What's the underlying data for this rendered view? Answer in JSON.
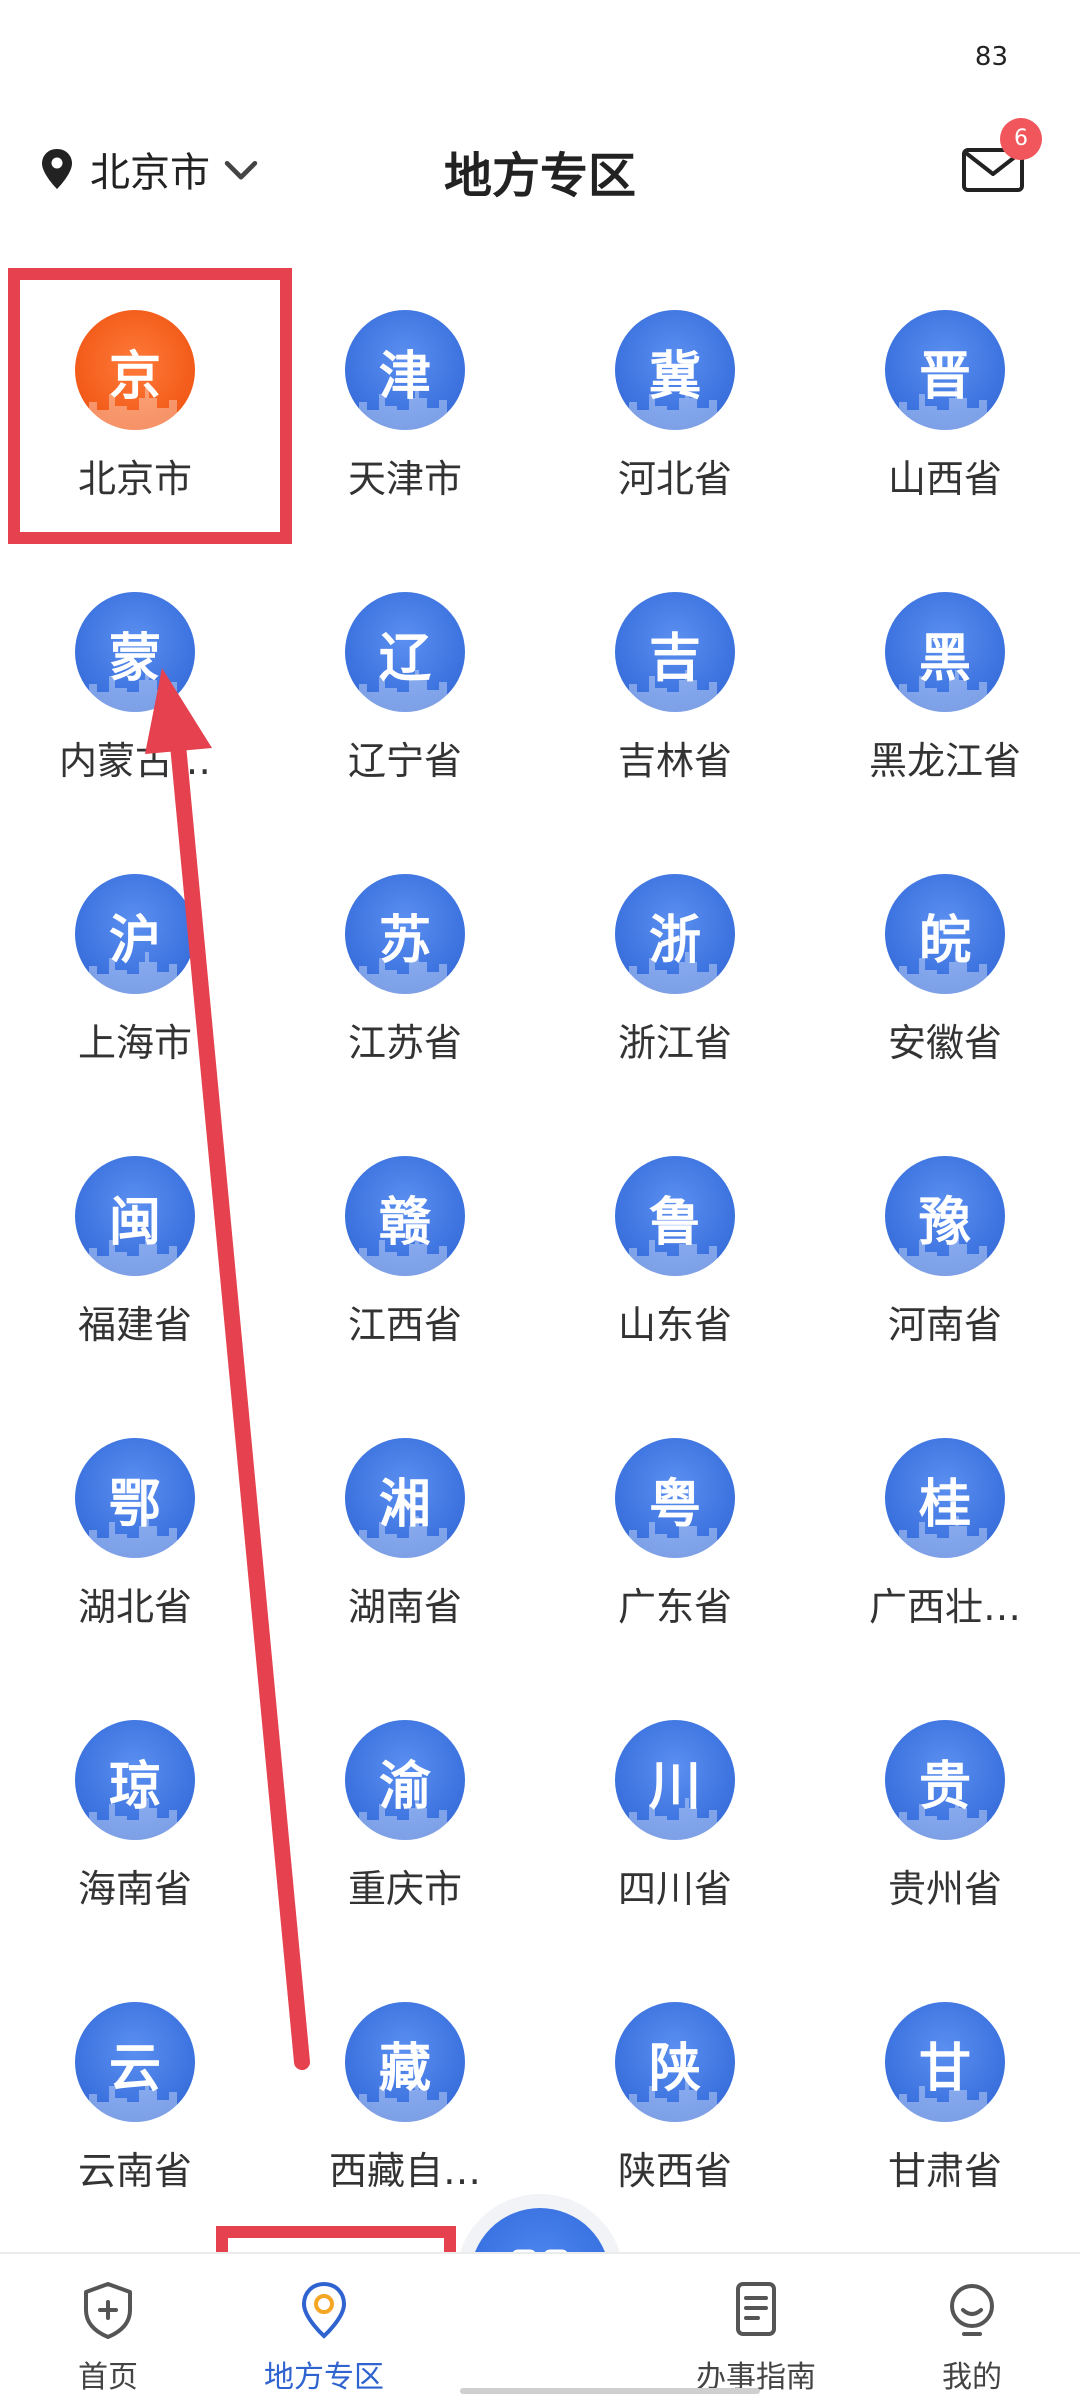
{
  "status": {
    "indicator": "83"
  },
  "header": {
    "location_icon": "location-pin-icon",
    "location_label": "北京市",
    "title": "地方专区",
    "mail_icon": "mail-icon",
    "mail_badge": "6"
  },
  "regions": [
    {
      "glyph": "京",
      "label": "北京市",
      "selected": true
    },
    {
      "glyph": "津",
      "label": "天津市"
    },
    {
      "glyph": "冀",
      "label": "河北省"
    },
    {
      "glyph": "晋",
      "label": "山西省"
    },
    {
      "glyph": "蒙",
      "label": "内蒙古…"
    },
    {
      "glyph": "辽",
      "label": "辽宁省"
    },
    {
      "glyph": "吉",
      "label": "吉林省"
    },
    {
      "glyph": "黑",
      "label": "黑龙江省"
    },
    {
      "glyph": "沪",
      "label": "上海市"
    },
    {
      "glyph": "苏",
      "label": "江苏省"
    },
    {
      "glyph": "浙",
      "label": "浙江省"
    },
    {
      "glyph": "皖",
      "label": "安徽省"
    },
    {
      "glyph": "闽",
      "label": "福建省"
    },
    {
      "glyph": "赣",
      "label": "江西省"
    },
    {
      "glyph": "鲁",
      "label": "山东省"
    },
    {
      "glyph": "豫",
      "label": "河南省"
    },
    {
      "glyph": "鄂",
      "label": "湖北省"
    },
    {
      "glyph": "湘",
      "label": "湖南省"
    },
    {
      "glyph": "粤",
      "label": "广东省"
    },
    {
      "glyph": "桂",
      "label": "广西壮…"
    },
    {
      "glyph": "琼",
      "label": "海南省"
    },
    {
      "glyph": "渝",
      "label": "重庆市"
    },
    {
      "glyph": "川",
      "label": "四川省"
    },
    {
      "glyph": "贵",
      "label": "贵州省"
    },
    {
      "glyph": "云",
      "label": "云南省"
    },
    {
      "glyph": "藏",
      "label": "西藏自…"
    },
    {
      "glyph": "陕",
      "label": "陕西省"
    },
    {
      "glyph": "甘",
      "label": "甘肃省"
    }
  ],
  "tabbar": {
    "tabs": [
      {
        "label": "首页",
        "icon": "shield-home-icon"
      },
      {
        "label": "地方专区",
        "icon": "location-pin-icon",
        "active": true
      },
      {
        "label": "办事指南",
        "icon": "document-guide-icon"
      },
      {
        "label": "我的",
        "icon": "user-smile-icon"
      }
    ],
    "scan_icon": "qr-scan-icon"
  },
  "colors": {
    "primary_blue": "#3e74e0",
    "selected_orange": "#f25a18",
    "annotation_red": "#e5414e",
    "badge_red": "#f0565b"
  }
}
